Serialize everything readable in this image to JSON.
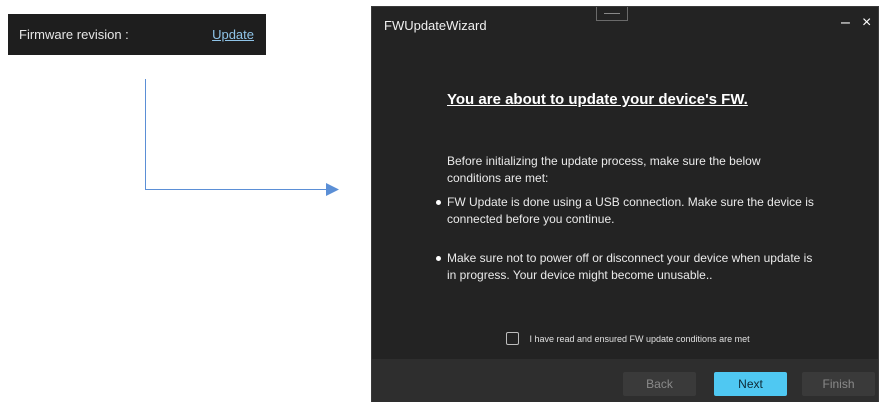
{
  "firmware_bar": {
    "label": "Firmware revision :",
    "update_link": "Update"
  },
  "wizard": {
    "title": "FWUpdateWizard",
    "minimize_glyph": "–",
    "close_glyph": "×",
    "heading": "You are about to update your device's FW.",
    "intro": "Before initializing the update process, make sure the below conditions are met:",
    "bullets": [
      "FW Update is done using a USB connection. Make sure the device is connected before you continue.",
      "Make sure not to power off or disconnect your device when update is in progress. Your device might become unusable.."
    ],
    "checkbox_label": "I have read and ensured FW update conditions are met",
    "checkbox_checked": false,
    "buttons": {
      "back": "Back",
      "next": "Next",
      "finish": "Finish"
    }
  },
  "colors": {
    "accent": "#4fc8f2",
    "window_bg": "#232323",
    "footer_bg": "#2e2e2e",
    "link": "#8fc4e8",
    "connector": "#5b8fd6"
  }
}
